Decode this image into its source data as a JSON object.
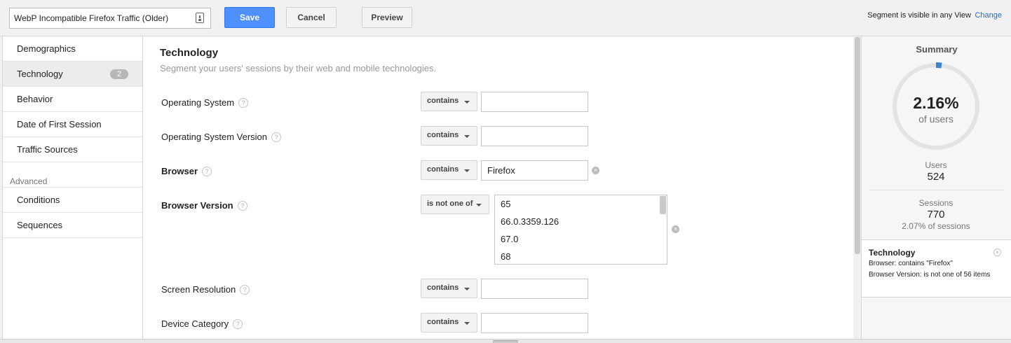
{
  "header": {
    "segment_name": "WebP Incompatible Firefox Traffic (Older)",
    "save_label": "Save",
    "cancel_label": "Cancel",
    "preview_label": "Preview",
    "visibility_text": "Segment is visible in any View",
    "change_label": "Change"
  },
  "sidebar": {
    "items": [
      {
        "label": "Demographics"
      },
      {
        "label": "Technology",
        "badge": "2",
        "active": true
      },
      {
        "label": "Behavior"
      },
      {
        "label": "Date of First Session"
      },
      {
        "label": "Traffic Sources"
      }
    ],
    "advanced_heading": "Advanced",
    "advanced_items": [
      {
        "label": "Conditions"
      },
      {
        "label": "Sequences"
      }
    ]
  },
  "main": {
    "title": "Technology",
    "subtitle": "Segment your users' sessions by their web and mobile technologies.",
    "help_glyph": "?",
    "clear_glyph": "×",
    "rows": [
      {
        "label": "Operating System",
        "operator": "contains",
        "value": ""
      },
      {
        "label": "Operating System Version",
        "operator": "contains",
        "value": ""
      },
      {
        "label": "Browser",
        "operator": "contains",
        "value": "Firefox",
        "active": true
      },
      {
        "label": "Browser Version",
        "operator": "is not one of",
        "active": true,
        "list": [
          "65",
          "66.0.3359.126",
          "67.0",
          "68"
        ]
      },
      {
        "label": "Screen Resolution",
        "operator": "contains",
        "value": ""
      },
      {
        "label": "Device Category",
        "operator": "contains",
        "value": ""
      }
    ]
  },
  "summary": {
    "title": "Summary",
    "percent": "2.16%",
    "percent_value": 2.16,
    "percent_sub": "of users",
    "users_label": "Users",
    "users_value": "524",
    "sessions_label": "Sessions",
    "sessions_value": "770",
    "sessions_note": "2.07% of sessions",
    "condition_title": "Technology",
    "condition_line1": "Browser: contains \"Firefox\"",
    "condition_line2": "Browser Version: is not one of 56 items",
    "close_glyph": "×"
  },
  "colors": {
    "accent": "#4d90fe",
    "link": "#1a6fc9",
    "gauge_track": "#e3e3e3",
    "gauge_fill": "#3a87d0"
  }
}
